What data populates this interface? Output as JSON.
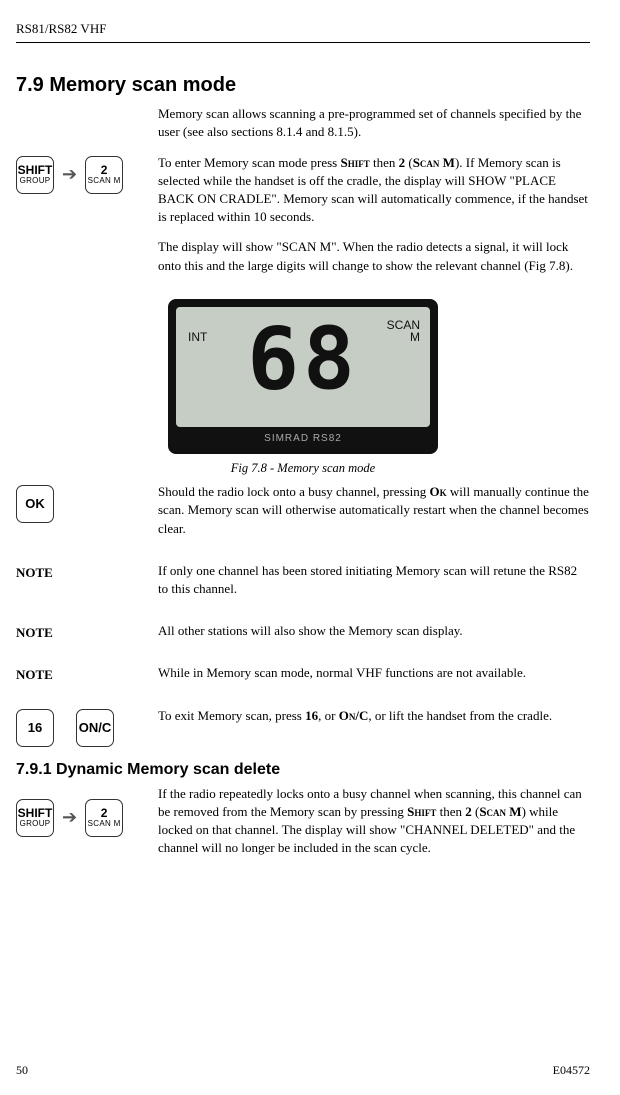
{
  "header": {
    "model": "RS81/RS82 VHF"
  },
  "section": {
    "number_title": "7.9  Memory scan mode",
    "intro": "Memory scan allows scanning a pre-programmed set of channels specified by the user (see also sections 8.1.4 and 8.1.5).",
    "p1a": "To enter Memory scan mode press ",
    "p1b": " then ",
    "p1c": " (",
    "p1d": "). If Memory scan is selected while the handset is off the cradle, the display will SHOW \"PLACE BACK ON CRADLE\". Memory scan will automatically commence, if the handset is replaced within 10 seconds.",
    "p2": "The display will show \"SCAN M\". When the radio detects a signal, it will lock onto this and the large digits will change to show the relevant channel (Fig 7.8).",
    "caption": "Fig 7.8 - Memory scan mode",
    "p3a": "Should the radio lock onto a busy channel, pressing ",
    "p3b": " will manually continue the scan. Memory scan will otherwise automatically restart when the channel becomes clear.",
    "note1": "If only one channel has been stored initiating Memory scan will retune the RS82 to this channel.",
    "note2": "All other stations will also show the Memory scan display.",
    "note3": "While in Memory scan mode, normal VHF functions are not available.",
    "p4a": "To exit Memory scan, press ",
    "p4b": ", or ",
    "p4c": ", or lift the handset from the cradle.",
    "sub_title": "7.9.1  Dynamic Memory scan delete",
    "p5a": "If the radio repeatedly locks onto a busy channel when scanning, this channel can be removed from the Memory scan by pressing ",
    "p5b": " then ",
    "p5c": " (",
    "p5d": ") while locked on that channel. The display will show \"CHANNEL DELETED\" and the channel will no longer be included in the scan cycle."
  },
  "tokens": {
    "shift": "Shift",
    "two": "2",
    "scanm": "Scan M",
    "ok": "Ok",
    "sixteen": "16",
    "onc": "On/C"
  },
  "keys": {
    "shift_top": "SHIFT",
    "shift_bot": "GROUP",
    "two_top": "2",
    "two_bot": "SCAN M",
    "ok": "OK",
    "sixteen": "16",
    "onc": "ON/C"
  },
  "labels": {
    "note": "NOTE"
  },
  "lcd": {
    "int": "INT",
    "scan": "SCAN",
    "m": "M",
    "digits": "68",
    "brand": "SIMRAD RS82"
  },
  "footer": {
    "page": "50",
    "code": "E04572"
  }
}
